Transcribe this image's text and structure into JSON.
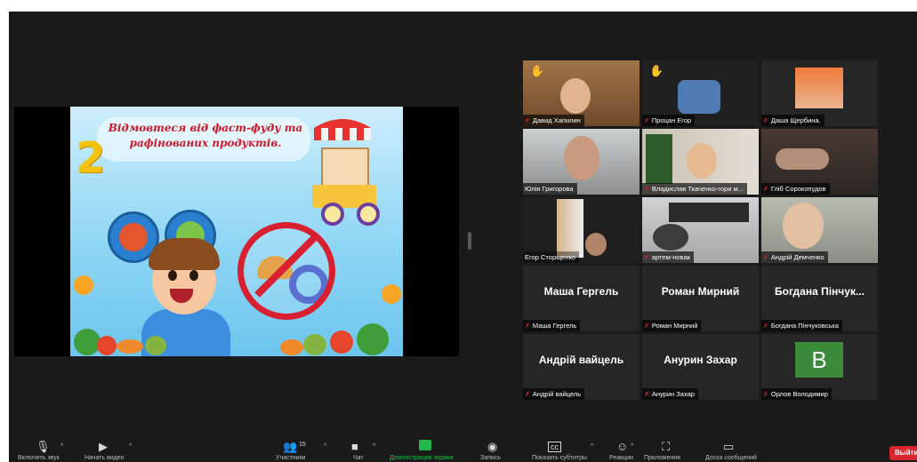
{
  "slide": {
    "number": "2",
    "title": "Відмовтеся від фаст-фуду та рафінованих продуктів."
  },
  "participants": [
    {
      "display": "Давид Хапилин",
      "hand": true
    },
    {
      "display": "Процан Егор",
      "hand": true
    },
    {
      "display": "Даша Щербина.",
      "hand": false
    },
    {
      "display": "Юлія Григорова",
      "active": true
    },
    {
      "display": "Владислав Ткаченко-гори м..."
    },
    {
      "display": "Гліб Сорокопудов"
    },
    {
      "display": "Егор Сторщенко"
    },
    {
      "display": "артем-новак"
    },
    {
      "display": "Андрій Демченко"
    },
    {
      "display": "Маша Гергель",
      "big": "Маша Гергель"
    },
    {
      "display": "Роман Мирний",
      "big": "Роман Мирний"
    },
    {
      "display": "Богдана Пінчуковська",
      "big": "Богдана Пінчук..."
    },
    {
      "display": "Андрій вайцель",
      "big": "Андрій вайцель"
    },
    {
      "display": "Анурин Захар",
      "big": "Анурин Захар"
    },
    {
      "display": "Орлов Володимир",
      "initial": "B"
    }
  ],
  "toolbar": {
    "unmute": "Включить звук",
    "video": "Начать видео",
    "participants": "Участники",
    "participants_count": "15",
    "chat": "Чат",
    "share": "Демонстрация экрана",
    "record": "Запись",
    "captions": "Показать субтитры",
    "reactions": "Реакции",
    "apps": "Приложения",
    "whiteboard": "Доска сообщений",
    "leave": "Выйти"
  },
  "colors": {
    "active_border": "#c6d83a",
    "leave": "#d9252e",
    "share": "#1fb84a",
    "mic_muted": "#e0262f",
    "avatar_bg": "#3b8b3b"
  }
}
